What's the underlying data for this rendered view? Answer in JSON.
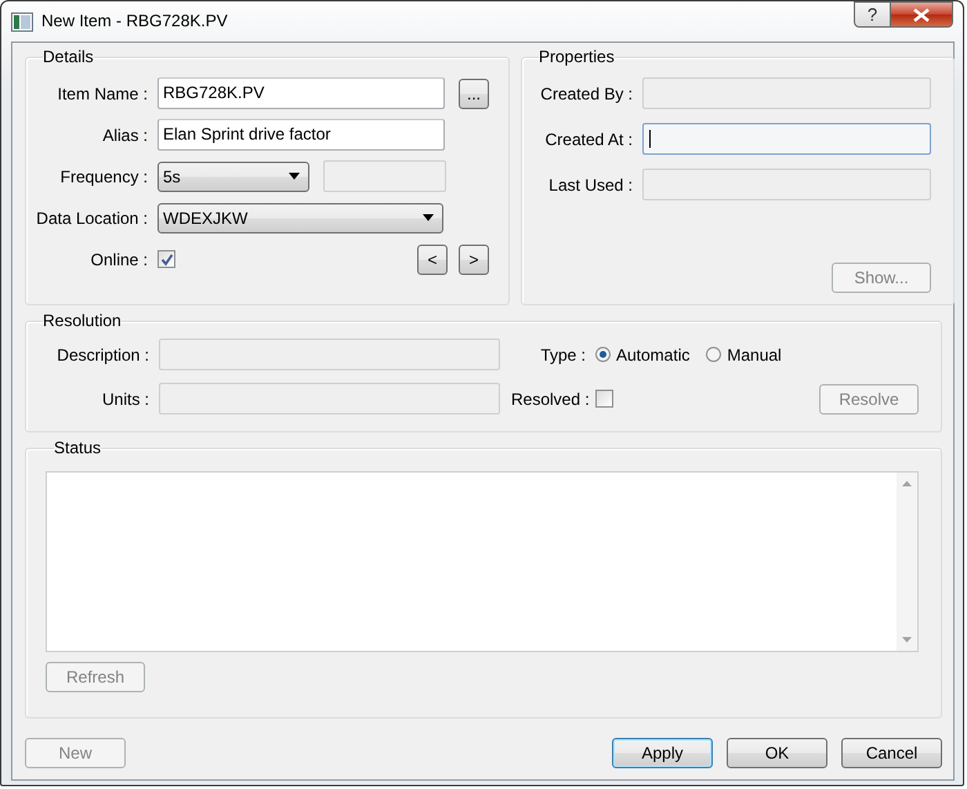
{
  "window": {
    "title": "New Item - RBG728K.PV",
    "help_button": "?"
  },
  "details": {
    "title": "Details",
    "rows": [
      {
        "kind": "text",
        "label": "Item Name :",
        "value": "RBG728K.PV",
        "disabled": false,
        "button": {
          "label": "...",
          "disabled": false
        }
      },
      {
        "kind": "text",
        "label": "Alias :",
        "value": "Elan Sprint drive factor",
        "disabled": false
      },
      {
        "kind": "combo",
        "label": "Frequency :",
        "value": "5s",
        "extra_field": {
          "disabled": true
        }
      },
      {
        "kind": "combo",
        "label": "Data Location :",
        "value": "WDEXJKW"
      },
      {
        "kind": "checkbox",
        "label": "Online :",
        "checked": true,
        "buttons": [
          {
            "label": "<",
            "disabled": false
          },
          {
            "label": ">",
            "disabled": false
          }
        ]
      }
    ]
  },
  "properties": {
    "title": "Properties",
    "fields": [
      {
        "label": "Created By :",
        "disabled": true,
        "focused": false
      },
      {
        "label": "Created At :",
        "disabled": true,
        "focused": true
      },
      {
        "label": "Last Used :",
        "disabled": true,
        "focused": false
      }
    ],
    "button": {
      "label": "Show...",
      "disabled": true
    }
  },
  "resolution": {
    "title": "Resolution",
    "fields": [
      {
        "label": "Description :",
        "disabled": true
      },
      {
        "label": "Units :",
        "disabled": true
      }
    ],
    "type": {
      "label": "Type :",
      "options": [
        {
          "label": "Automatic",
          "selected": true
        },
        {
          "label": "Manual",
          "selected": false
        }
      ]
    },
    "resolved": {
      "label": "Resolved :",
      "checked": false
    },
    "button": {
      "label": "Resolve",
      "disabled": true
    }
  },
  "status": {
    "title": "Status",
    "button": {
      "label": "Refresh",
      "disabled": true
    }
  },
  "footer": {
    "left_buttons": [
      {
        "label": "New",
        "disabled": true,
        "default": false
      }
    ],
    "right_buttons": [
      {
        "label": "Apply",
        "disabled": false,
        "default": true
      },
      {
        "label": "OK",
        "disabled": false,
        "default": false
      },
      {
        "label": "Cancel",
        "disabled": false,
        "default": false
      }
    ]
  }
}
